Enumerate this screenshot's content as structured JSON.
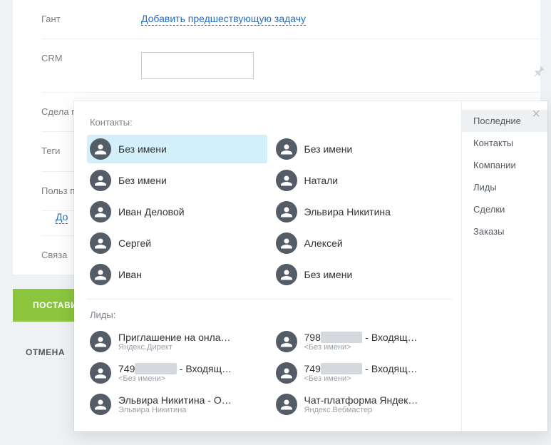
{
  "form": {
    "gantt_label": "Гант",
    "gantt_link": "Добавить предшествующую задачу",
    "crm_label": "CRM",
    "crm_value": "",
    "crm_placeholder": "",
    "subtask_label": "Сдела подзад",
    "tags_label": "Теги",
    "fields_label": "Польз поля",
    "fields_link": "До",
    "links_label": "Связа"
  },
  "buttons": {
    "submit": "ПОСТАВИТ",
    "secondary": "",
    "cancel": "ОТМЕНА"
  },
  "popover": {
    "section_contacts": "Контакты:",
    "section_leads": "Лиды:",
    "contacts_left": [
      {
        "name": "Без имени"
      },
      {
        "name": "Без имени"
      },
      {
        "name": "Иван Деловой"
      },
      {
        "name": "Сергей"
      },
      {
        "name": "Иван"
      }
    ],
    "contacts_right": [
      {
        "name": "Без имени"
      },
      {
        "name": "Натали"
      },
      {
        "name": "Эльвира Никитина"
      },
      {
        "name": "Алексей"
      },
      {
        "name": "Без имени"
      }
    ],
    "leads_left": [
      {
        "name": "Приглашение на онлай…",
        "sub": "Яндекс.Директ"
      },
      {
        "name": "749________ - Входящ…",
        "sub": "<Без имени>",
        "redacted": true
      },
      {
        "name": "Эльвира Никитина - О…",
        "sub": "Эльвира Никитина"
      }
    ],
    "leads_right": [
      {
        "name": "798________ - Входящ…",
        "sub": "<Без имени>",
        "redacted": true
      },
      {
        "name": "749________ - Входящ…",
        "sub": "<Без имени>",
        "redacted": true
      },
      {
        "name": "Чат-платформа Яндек…",
        "sub": "Яндекс.Вебмастер"
      }
    ],
    "side": [
      {
        "label": "Последние",
        "active": true
      },
      {
        "label": "Контакты"
      },
      {
        "label": "Компании"
      },
      {
        "label": "Лиды"
      },
      {
        "label": "Сделки"
      },
      {
        "label": "Заказы"
      }
    ]
  }
}
